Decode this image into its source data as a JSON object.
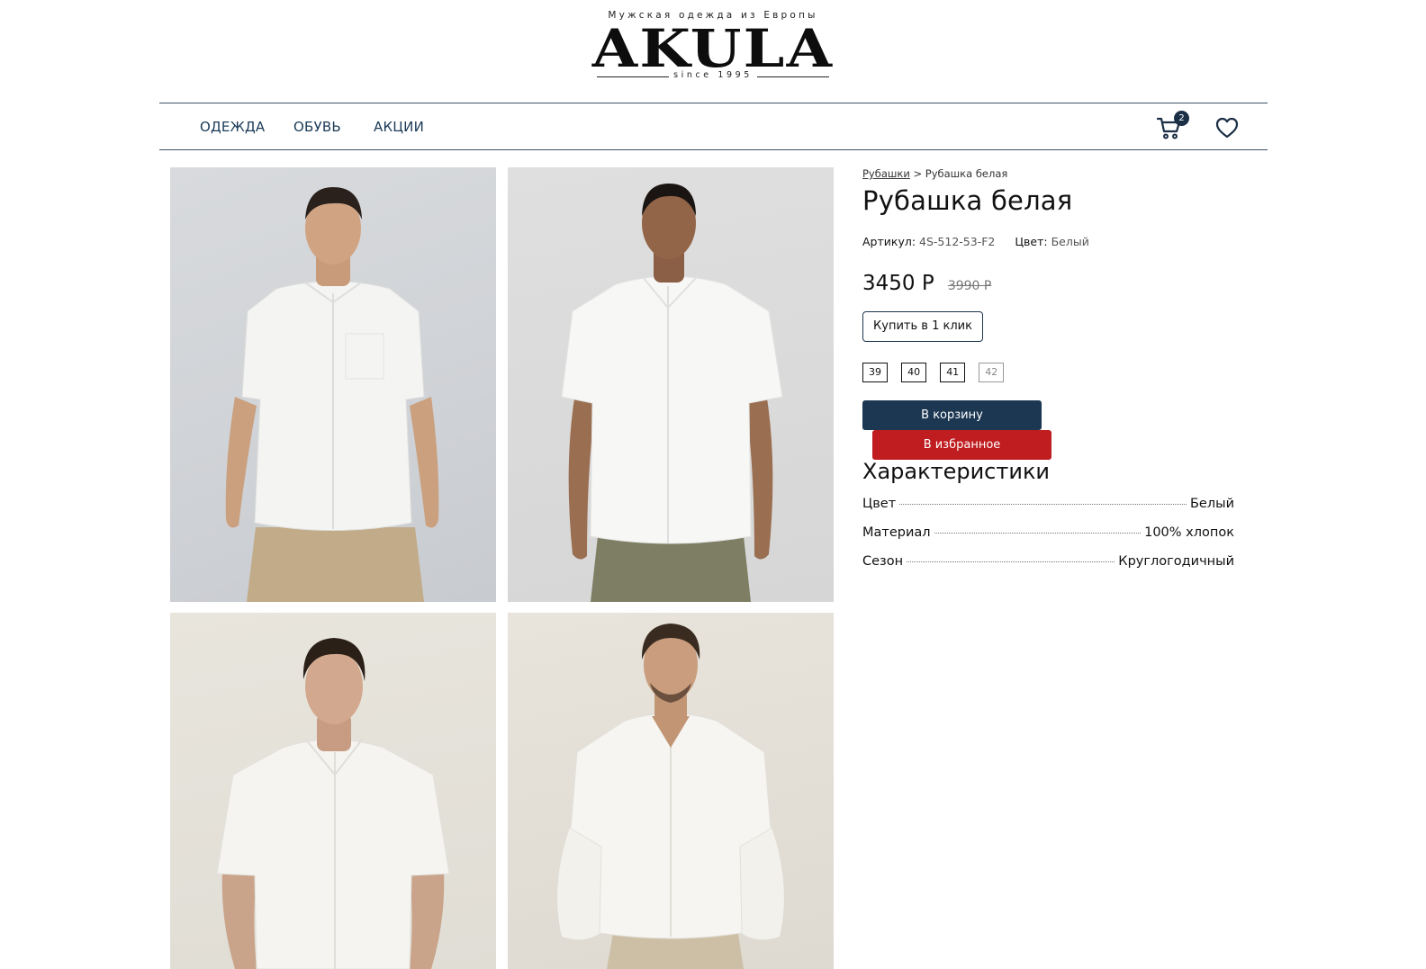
{
  "brand": {
    "tagline": "Мужская одежда из Европы",
    "name": "AKULA",
    "since": "since 1995"
  },
  "nav": {
    "items": [
      {
        "label": "ОДЕЖДА"
      },
      {
        "label": "ОБУВЬ"
      },
      {
        "label": "АКЦИИ"
      }
    ],
    "cart_icon": "cart-icon",
    "cart_count": "2",
    "favorites_icon": "heart-icon"
  },
  "gallery": {
    "photos": [
      {
        "subject": "man-white-shirt-front-pocket"
      },
      {
        "subject": "man-white-shirt-front"
      },
      {
        "subject": "man-white-shirt-portrait"
      },
      {
        "subject": "man-white-linen-shirt"
      }
    ]
  },
  "product": {
    "breadcrumb": {
      "category": "Рубашки",
      "separator": ">",
      "current": "Рубашка белая"
    },
    "title": "Рубашка белая",
    "article_label": "Артикул:",
    "article_value": "4S-512-53-F2",
    "color_label": "Цвет:",
    "color_value": "Белый",
    "price_current": "3450 Р",
    "price_old": "3990 Р",
    "one_click_label": "Купить в 1 клик",
    "sizes": [
      {
        "label": "39",
        "available": true
      },
      {
        "label": "40",
        "available": true
      },
      {
        "label": "41",
        "available": true
      },
      {
        "label": "42",
        "available": false
      }
    ],
    "add_to_cart_label": "В корзину",
    "add_to_favorites_label": "В избранное",
    "specs_title": "Характеристики",
    "specs": [
      {
        "name": "Цвет",
        "value": "Белый"
      },
      {
        "name": "Материал",
        "value": "100% хлопок"
      },
      {
        "name": "Сезон",
        "value": "Круглогодичный"
      }
    ]
  },
  "colors": {
    "primary": "#1c3752",
    "accent_red": "#bf1d20",
    "nav_text": "#1b3a57"
  }
}
